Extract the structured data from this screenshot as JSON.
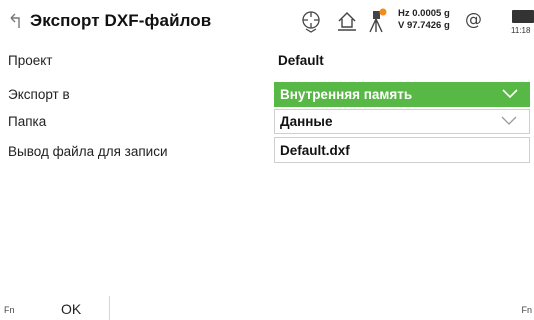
{
  "header": {
    "title": "Экспорт DXF-файлов",
    "back_icon": "back-arrow-icon",
    "status": {
      "hz": "Hz 0.0005 g",
      "v": "V  97.7426 g",
      "at_symbol": "@",
      "time": "11:18",
      "icons": [
        "target-icon",
        "home-icon",
        "tripod-icon",
        "at-icon",
        "battery-icon"
      ]
    }
  },
  "form": {
    "project": {
      "label": "Проект",
      "value": "Default"
    },
    "export_to": {
      "label": "Экспорт в",
      "value": "Внутренняя память",
      "accent": "#57b846"
    },
    "folder": {
      "label": "Папка",
      "value": "Данные"
    },
    "output_file": {
      "label": "Вывод файла для записи",
      "value": "Default.dxf"
    }
  },
  "softkeys": {
    "fn_left": "Fn",
    "ok": "OK",
    "fn_right": "Fn"
  }
}
